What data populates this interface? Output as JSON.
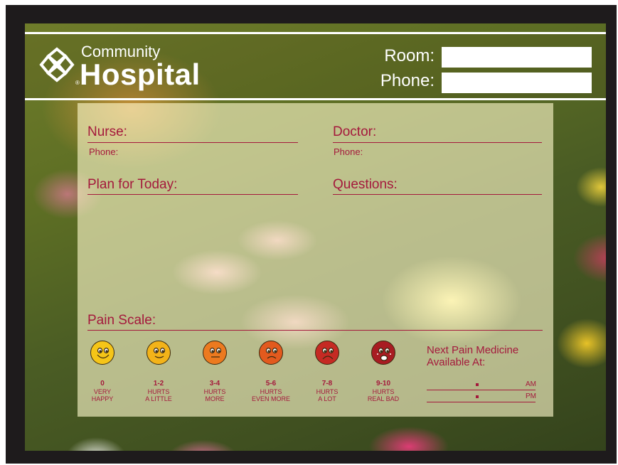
{
  "brand": {
    "line1": "Community",
    "line2": "Hospital",
    "registered": "®"
  },
  "header": {
    "room_label": "Room:",
    "phone_label": "Phone:",
    "room_value": "",
    "phone_value": ""
  },
  "fields": {
    "nurse": {
      "title": "Nurse:",
      "phone": "Phone:"
    },
    "doctor": {
      "title": "Doctor:",
      "phone": "Phone:"
    },
    "plan": "Plan for Today:",
    "questions": "Questions:"
  },
  "pain_scale": {
    "title": "Pain Scale:",
    "levels": [
      {
        "range": "0",
        "line1": "VERY",
        "line2": "HAPPY",
        "color": "#f5c518",
        "mood": "very-happy"
      },
      {
        "range": "1-2",
        "line1": "HURTS",
        "line2": "A LITTLE",
        "color": "#f3b319",
        "mood": "happy"
      },
      {
        "range": "3-4",
        "line1": "HURTS",
        "line2": "MORE",
        "color": "#ec7a1f",
        "mood": "neutral"
      },
      {
        "range": "5-6",
        "line1": "HURTS",
        "line2": "EVEN MORE",
        "color": "#e25a1e",
        "mood": "sad"
      },
      {
        "range": "7-8",
        "line1": "HURTS",
        "line2": "A LOT",
        "color": "#c52a23",
        "mood": "very-sad"
      },
      {
        "range": "9-10",
        "line1": "HURTS",
        "line2": "REAL BAD",
        "color": "#a81c22",
        "mood": "crying"
      }
    ]
  },
  "next_medicine": {
    "title": "Next Pain Medicine Available At:",
    "am": "AM",
    "pm": "PM"
  },
  "colors": {
    "accent": "#a4193c",
    "frame": "#1e1b1c",
    "panel": "#fffacd"
  }
}
